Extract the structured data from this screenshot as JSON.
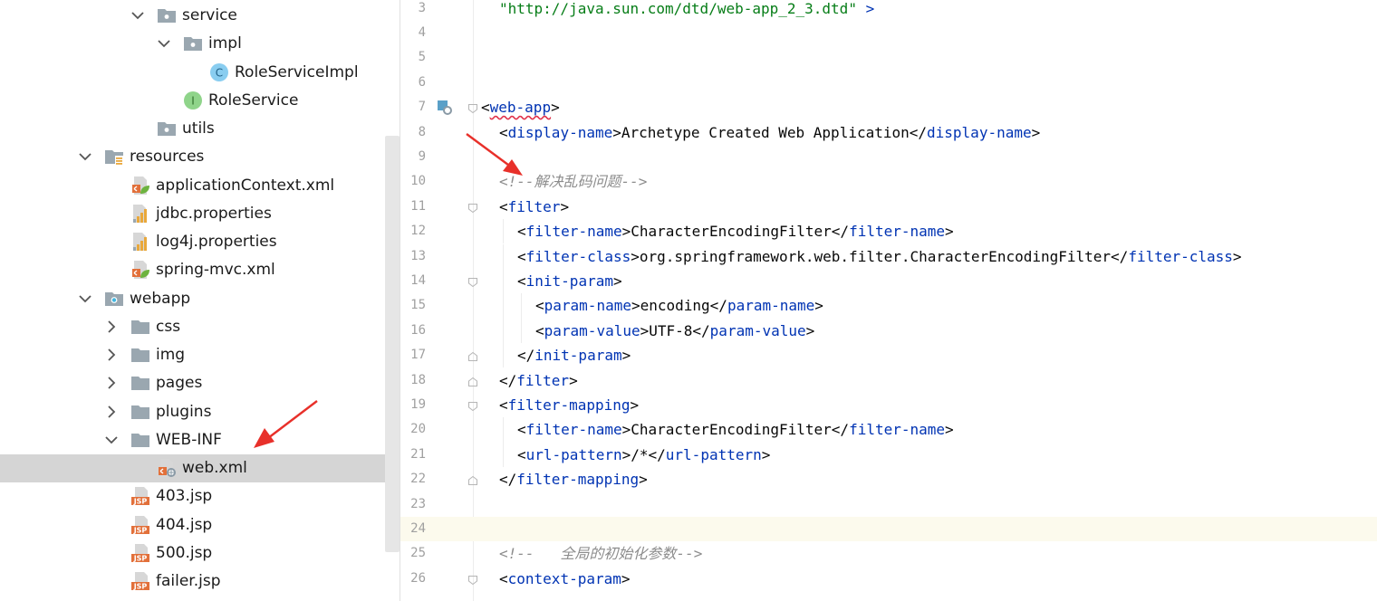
{
  "project_tree": {
    "items": [
      {
        "label": "service",
        "depth": 5,
        "kind": "package",
        "chevron": "down",
        "selected": false
      },
      {
        "label": "impl",
        "depth": 6,
        "kind": "package",
        "chevron": "down",
        "selected": false
      },
      {
        "label": "RoleServiceImpl",
        "depth": 7,
        "kind": "class",
        "chevron": "none",
        "selected": false
      },
      {
        "label": "RoleService",
        "depth": 6,
        "kind": "interface",
        "chevron": "none",
        "selected": false
      },
      {
        "label": "utils",
        "depth": 5,
        "kind": "package",
        "chevron": "none",
        "selected": false
      },
      {
        "label": "resources",
        "depth": 3,
        "kind": "resources-folder",
        "chevron": "down",
        "selected": false
      },
      {
        "label": "applicationContext.xml",
        "depth": 4,
        "kind": "spring-xml",
        "chevron": "none",
        "selected": false
      },
      {
        "label": "jdbc.properties",
        "depth": 4,
        "kind": "properties",
        "chevron": "none",
        "selected": false
      },
      {
        "label": "log4j.properties",
        "depth": 4,
        "kind": "properties",
        "chevron": "none",
        "selected": false
      },
      {
        "label": "spring-mvc.xml",
        "depth": 4,
        "kind": "spring-xml",
        "chevron": "none",
        "selected": false
      },
      {
        "label": "webapp",
        "depth": 3,
        "kind": "web-folder",
        "chevron": "down",
        "selected": false
      },
      {
        "label": "css",
        "depth": 4,
        "kind": "folder",
        "chevron": "right",
        "selected": false
      },
      {
        "label": "img",
        "depth": 4,
        "kind": "folder",
        "chevron": "right",
        "selected": false
      },
      {
        "label": "pages",
        "depth": 4,
        "kind": "folder",
        "chevron": "right",
        "selected": false
      },
      {
        "label": "plugins",
        "depth": 4,
        "kind": "folder",
        "chevron": "right",
        "selected": false
      },
      {
        "label": "WEB-INF",
        "depth": 4,
        "kind": "folder",
        "chevron": "down",
        "selected": false
      },
      {
        "label": "web.xml",
        "depth": 5,
        "kind": "web-xml",
        "chevron": "none",
        "selected": true
      },
      {
        "label": "403.jsp",
        "depth": 4,
        "kind": "jsp",
        "chevron": "none",
        "selected": false
      },
      {
        "label": "404.jsp",
        "depth": 4,
        "kind": "jsp",
        "chevron": "none",
        "selected": false
      },
      {
        "label": "500.jsp",
        "depth": 4,
        "kind": "jsp",
        "chevron": "none",
        "selected": false
      },
      {
        "label": "failer.jsp",
        "depth": 4,
        "kind": "jsp",
        "chevron": "none",
        "selected": false
      }
    ]
  },
  "editor": {
    "current_line": "24",
    "lines": [
      {
        "n": "3",
        "indent": 1,
        "fold": "none",
        "parts": [
          {
            "t": "\"http://java.sun.com/dtd/web-app_2_3.dtd\"",
            "c": "str"
          },
          {
            "t": " >",
            "c": "tag"
          }
        ]
      },
      {
        "n": "4",
        "indent": 0,
        "fold": "none",
        "parts": []
      },
      {
        "n": "5",
        "indent": 0,
        "fold": "none",
        "parts": []
      },
      {
        "n": "6",
        "indent": 0,
        "fold": "none",
        "parts": []
      },
      {
        "n": "7",
        "indent": 0,
        "fold": "open",
        "marker": "web-descriptor-icon",
        "parts": [
          {
            "t": "<",
            "c": "txt"
          },
          {
            "t": "web-app",
            "c": "tag-err"
          },
          {
            "t": ">",
            "c": "txt"
          }
        ]
      },
      {
        "n": "8",
        "indent": 1,
        "fold": "none",
        "parts": [
          {
            "t": "<",
            "c": "txt"
          },
          {
            "t": "display-name",
            "c": "tag"
          },
          {
            "t": ">Archetype Created Web Application</",
            "c": "txt"
          },
          {
            "t": "display-name",
            "c": "tag"
          },
          {
            "t": ">",
            "c": "txt"
          }
        ]
      },
      {
        "n": "9",
        "indent": 0,
        "fold": "none",
        "parts": []
      },
      {
        "n": "10",
        "indent": 1,
        "fold": "none",
        "parts": [
          {
            "t": "<!--解决乱码问题-->",
            "c": "com"
          }
        ]
      },
      {
        "n": "11",
        "indent": 1,
        "fold": "open",
        "parts": [
          {
            "t": "<",
            "c": "txt"
          },
          {
            "t": "filter",
            "c": "tag"
          },
          {
            "t": ">",
            "c": "txt"
          }
        ]
      },
      {
        "n": "12",
        "indent": 2,
        "fold": "none",
        "parts": [
          {
            "t": "<",
            "c": "txt"
          },
          {
            "t": "filter-name",
            "c": "tag"
          },
          {
            "t": ">CharacterEncodingFilter</",
            "c": "txt"
          },
          {
            "t": "filter-name",
            "c": "tag"
          },
          {
            "t": ">",
            "c": "txt"
          }
        ]
      },
      {
        "n": "13",
        "indent": 2,
        "fold": "none",
        "parts": [
          {
            "t": "<",
            "c": "txt"
          },
          {
            "t": "filter-class",
            "c": "tag"
          },
          {
            "t": ">org.springframework.web.filter.CharacterEncodingFilter</",
            "c": "txt"
          },
          {
            "t": "filter-class",
            "c": "tag"
          },
          {
            "t": ">",
            "c": "txt"
          }
        ]
      },
      {
        "n": "14",
        "indent": 2,
        "fold": "open",
        "parts": [
          {
            "t": "<",
            "c": "txt"
          },
          {
            "t": "init-param",
            "c": "tag"
          },
          {
            "t": ">",
            "c": "txt"
          }
        ]
      },
      {
        "n": "15",
        "indent": 3,
        "fold": "none",
        "parts": [
          {
            "t": "<",
            "c": "txt"
          },
          {
            "t": "param-name",
            "c": "tag"
          },
          {
            "t": ">encoding</",
            "c": "txt"
          },
          {
            "t": "param-name",
            "c": "tag"
          },
          {
            "t": ">",
            "c": "txt"
          }
        ]
      },
      {
        "n": "16",
        "indent": 3,
        "fold": "none",
        "parts": [
          {
            "t": "<",
            "c": "txt"
          },
          {
            "t": "param-value",
            "c": "tag"
          },
          {
            "t": ">UTF-8</",
            "c": "txt"
          },
          {
            "t": "param-value",
            "c": "tag"
          },
          {
            "t": ">",
            "c": "txt"
          }
        ]
      },
      {
        "n": "17",
        "indent": 2,
        "fold": "close",
        "parts": [
          {
            "t": "</",
            "c": "txt"
          },
          {
            "t": "init-param",
            "c": "tag"
          },
          {
            "t": ">",
            "c": "txt"
          }
        ]
      },
      {
        "n": "18",
        "indent": 1,
        "fold": "close",
        "parts": [
          {
            "t": "</",
            "c": "txt"
          },
          {
            "t": "filter",
            "c": "tag"
          },
          {
            "t": ">",
            "c": "txt"
          }
        ]
      },
      {
        "n": "19",
        "indent": 1,
        "fold": "open",
        "parts": [
          {
            "t": "<",
            "c": "txt"
          },
          {
            "t": "filter-mapping",
            "c": "tag"
          },
          {
            "t": ">",
            "c": "txt"
          }
        ]
      },
      {
        "n": "20",
        "indent": 2,
        "fold": "none",
        "parts": [
          {
            "t": "<",
            "c": "txt"
          },
          {
            "t": "filter-name",
            "c": "tag"
          },
          {
            "t": ">CharacterEncodingFilter</",
            "c": "txt"
          },
          {
            "t": "filter-name",
            "c": "tag"
          },
          {
            "t": ">",
            "c": "txt"
          }
        ]
      },
      {
        "n": "21",
        "indent": 2,
        "fold": "none",
        "parts": [
          {
            "t": "<",
            "c": "txt"
          },
          {
            "t": "url-pattern",
            "c": "tag"
          },
          {
            "t": ">/*</",
            "c": "txt"
          },
          {
            "t": "url-pattern",
            "c": "tag"
          },
          {
            "t": ">",
            "c": "txt"
          }
        ]
      },
      {
        "n": "22",
        "indent": 1,
        "fold": "close",
        "parts": [
          {
            "t": "</",
            "c": "txt"
          },
          {
            "t": "filter-mapping",
            "c": "tag"
          },
          {
            "t": ">",
            "c": "txt"
          }
        ]
      },
      {
        "n": "23",
        "indent": 0,
        "fold": "none",
        "parts": []
      },
      {
        "n": "24",
        "indent": 0,
        "fold": "none",
        "parts": []
      },
      {
        "n": "25",
        "indent": 1,
        "fold": "none",
        "parts": [
          {
            "t": "<!--   全局的初始化参数-->",
            "c": "com"
          }
        ]
      },
      {
        "n": "26",
        "indent": 1,
        "fold": "open",
        "parts": [
          {
            "t": "<",
            "c": "txt"
          },
          {
            "t": "context-param",
            "c": "tag"
          },
          {
            "t": ">",
            "c": "txt"
          }
        ]
      }
    ]
  },
  "colors": {
    "tag": "#0033b3",
    "string": "#067d17",
    "comment": "#8c8c8c",
    "text": "#080808",
    "selection": "#d5d5d5",
    "current_line": "#fcfaed",
    "annotation_arrow": "#e8302a"
  }
}
